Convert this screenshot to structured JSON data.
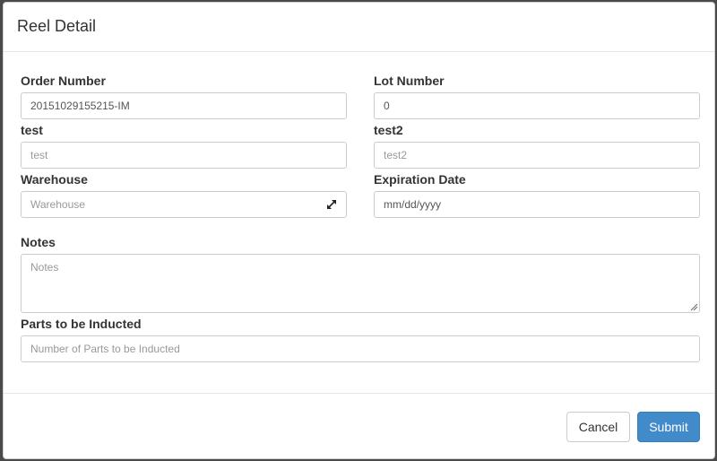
{
  "modal": {
    "title": "Reel Detail"
  },
  "form": {
    "order_number": {
      "label": "Order Number",
      "value": "20151029155215-IM"
    },
    "lot_number": {
      "label": "Lot Number",
      "value": "0"
    },
    "test": {
      "label": "test",
      "placeholder": "test"
    },
    "test2": {
      "label": "test2",
      "placeholder": "test2"
    },
    "warehouse": {
      "label": "Warehouse",
      "placeholder": "Warehouse",
      "icon": "expand-icon"
    },
    "expiration_date": {
      "label": "Expiration Date",
      "placeholder": "mm/dd/yyyy"
    },
    "notes": {
      "label": "Notes",
      "placeholder": "Notes"
    },
    "parts_to_be_inducted": {
      "label": "Parts to be Inducted",
      "placeholder": "Number of Parts to be Inducted"
    }
  },
  "footer": {
    "cancel_label": "Cancel",
    "submit_label": "Submit"
  },
  "colors": {
    "primary": "#428bca",
    "border": "#cccccc",
    "placeholder": "#999999"
  }
}
